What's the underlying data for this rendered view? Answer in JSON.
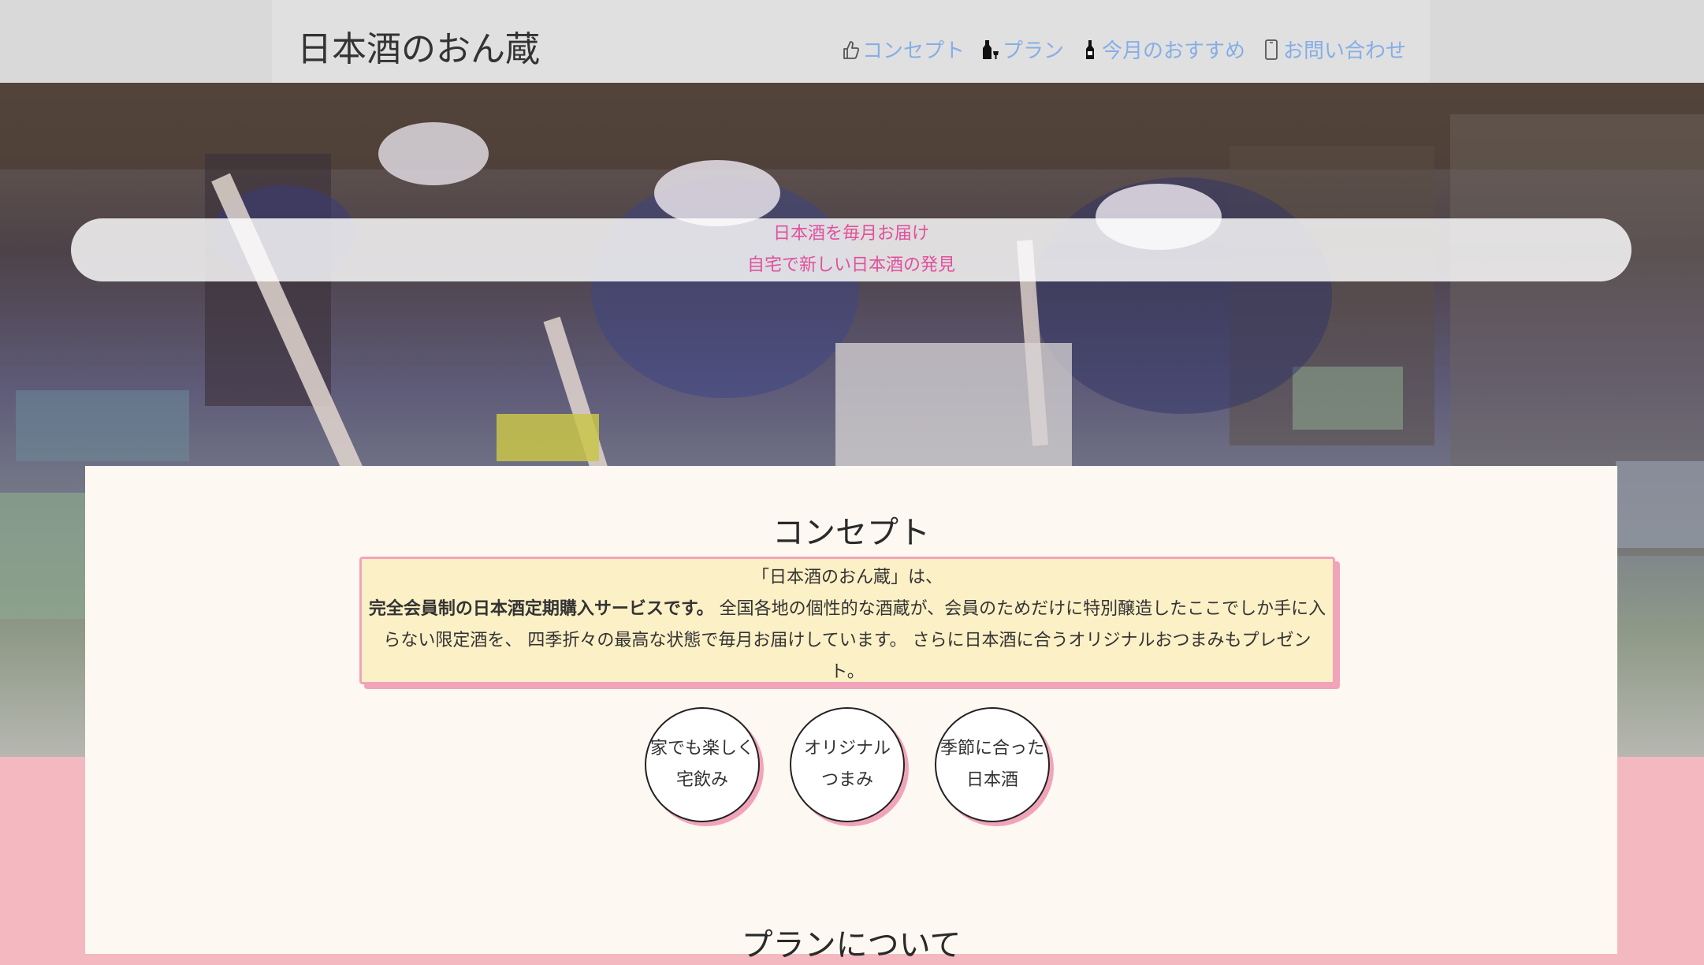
{
  "header": {
    "title": "日本酒のおん蔵",
    "nav": [
      {
        "icon": "thumbs-up-icon",
        "label": "コンセプト"
      },
      {
        "icon": "bottle-glass-icon",
        "label": "プラン"
      },
      {
        "icon": "wine-bottle-icon",
        "label": "今月のおすすめ"
      },
      {
        "icon": "phone-icon",
        "label": "お問い合わせ"
      }
    ]
  },
  "hero": {
    "line1": "日本酒を毎月お届け",
    "line2": "自宅で新しい日本酒の発見"
  },
  "concept": {
    "title": "コンセプト",
    "line1": "「日本酒のおん蔵」は、",
    "line2_bold": "完全会員制の日本酒定期購入サービスです。",
    "line2_rest": " 全国各地の個性的な酒蔵が、会員のためだけに特別醸造したここでしか手に入らない限定酒を、 四季折々の最高な状態で毎月お届けしています。 さらに日本酒に合うオリジナルおつまみもプレゼント。",
    "features": [
      {
        "line1": "家でも楽しく",
        "line2": "宅飲み"
      },
      {
        "line1": "オリジナル",
        "line2": "つまみ"
      },
      {
        "line1": "季節に合った",
        "line2": "日本酒"
      }
    ]
  },
  "plan": {
    "title": "プランについて"
  },
  "colors": {
    "accent_pink": "#e0509c",
    "nav_blue": "#86aee6",
    "page_pink": "#f4b8c1",
    "box_yellow": "#fbf0c6"
  }
}
